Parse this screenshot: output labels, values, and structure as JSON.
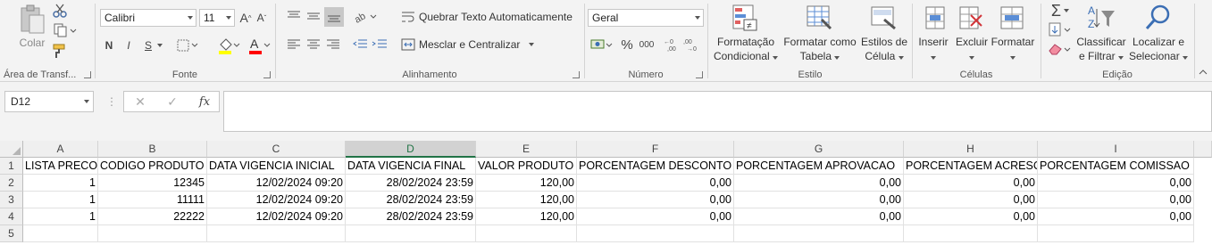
{
  "ribbon": {
    "clipboard": {
      "paste_label": "Colar",
      "group_label": "Área de Transf..."
    },
    "font": {
      "font_name": "Calibri",
      "font_size": "11",
      "bold": "N",
      "italic": "I",
      "underline": "S",
      "group_label": "Fonte",
      "font_color": "#ff0000",
      "highlight_color": "#ffff00"
    },
    "alignment": {
      "wrap_text": "Quebrar Texto Automaticamente",
      "merge_center": "Mesclar e Centralizar",
      "group_label": "Alinhamento"
    },
    "number": {
      "format": "Geral",
      "percent": "%",
      "thousands": "000",
      "group_label": "Número"
    },
    "styles": {
      "conditional_1": "Formatação",
      "conditional_2": "Condicional",
      "format_table_1": "Formatar como",
      "format_table_2": "Tabela",
      "cell_styles_1": "Estilos de",
      "cell_styles_2": "Célula",
      "group_label": "Estilo"
    },
    "cells": {
      "insert": "Inserir",
      "delete": "Excluir",
      "format": "Formatar",
      "group_label": "Células"
    },
    "editing": {
      "sum_icon": "Σ",
      "sort_1": "Classificar",
      "sort_2": "e Filtrar",
      "find_1": "Localizar e",
      "find_2": "Selecionar",
      "group_label": "Edição"
    }
  },
  "formula_bar": {
    "name_box": "D12",
    "fx": "fx",
    "formula": ""
  },
  "sheet": {
    "columns": [
      "A",
      "B",
      "C",
      "D",
      "E",
      "F",
      "G",
      "H",
      "I"
    ],
    "selected_column": "D",
    "row_numbers": [
      "1",
      "2",
      "3",
      "4",
      "5"
    ],
    "header_row": [
      "LISTA PRECO",
      "CODIGO PRODUTO",
      "DATA VIGENCIA INICIAL",
      "DATA VIGENCIA FINAL",
      "VALOR PRODUTO",
      "PORCENTAGEM DESCONTO",
      "PORCENTAGEM APROVACAO",
      "PORCENTAGEM ACRESCI",
      "PORCENTAGEM COMISSAO"
    ],
    "rows": [
      [
        "1",
        "12345",
        "12/02/2024 09:20",
        "28/02/2024 23:59",
        "120,00",
        "0,00",
        "0,00",
        "0,00",
        "0,00"
      ],
      [
        "1",
        "11111",
        "12/02/2024 09:20",
        "28/02/2024 23:59",
        "120,00",
        "0,00",
        "0,00",
        "0,00",
        "0,00"
      ],
      [
        "1",
        "22222",
        "12/02/2024 09:20",
        "28/02/2024 23:59",
        "120,00",
        "0,00",
        "0,00",
        "0,00",
        "0,00"
      ]
    ]
  },
  "colors": {
    "accent": "#217346",
    "ribbon_bg": "#f3f3f3"
  }
}
